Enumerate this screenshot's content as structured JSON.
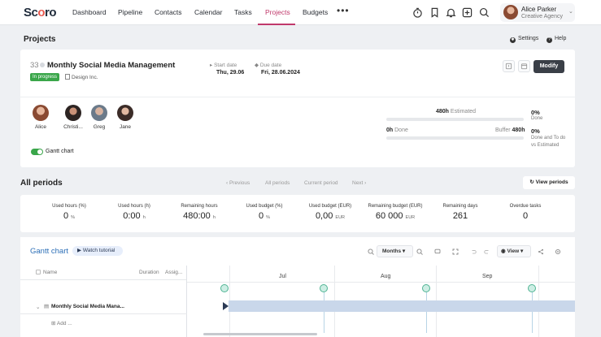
{
  "nav": {
    "logo_prefix": "Sc",
    "logo_o": "o",
    "logo_suffix": "ro",
    "items": [
      "Dashboard",
      "Pipeline",
      "Contacts",
      "Calendar",
      "Tasks",
      "Projects",
      "Budgets"
    ],
    "more": "•••",
    "active": "Projects"
  },
  "user": {
    "name": "Alice Parker",
    "agency": "Creative Agency"
  },
  "page": {
    "title": "Projects",
    "settings": "Settings",
    "help": "Help"
  },
  "project": {
    "number": "33",
    "title": "Monthly Social Media Management",
    "status": "In progress",
    "client": "Design Inc.",
    "start_label": "Start date",
    "start_value": "Thu, 29.06",
    "due_label": "Due date",
    "due_value": "Fri, 28.06.2024",
    "modify": "Modify"
  },
  "members": [
    {
      "name": "Alice"
    },
    {
      "name": "Christi..."
    },
    {
      "name": "Greg"
    },
    {
      "name": "Jane"
    }
  ],
  "gantt_toggle": {
    "label": "Gantt chart",
    "on": true
  },
  "stats": {
    "estimated_hours": "480h",
    "estimated_label": "Estimated",
    "done_hours": "0h",
    "done_label": "Done",
    "buffer_label": "Buffer",
    "buffer_hours": "480h",
    "pct_done": "0%",
    "pct_done_label": "Done",
    "pct_done_todo": "0%",
    "pct_done_todo_label1": "Done and To do",
    "pct_done_todo_label2": "vs Estimated"
  },
  "periods": {
    "title": "All periods",
    "previous": "‹ Previous",
    "all": "All periods",
    "current": "Current period",
    "next": "Next ›",
    "view": "View periods"
  },
  "metrics": [
    {
      "label": "Used hours (%)",
      "value": "0",
      "unit": "%"
    },
    {
      "label": "Used hours (h)",
      "value": "0:00",
      "unit": "h"
    },
    {
      "label": "Remaining hours",
      "value": "480:00",
      "unit": "h"
    },
    {
      "label": "Used budget (%)",
      "value": "0",
      "unit": "%"
    },
    {
      "label": "Used budget (EUR)",
      "value": "0,00",
      "unit": "EUR"
    },
    {
      "label": "Remaining budget (EUR)",
      "value": "60 000",
      "unit": "EUR"
    },
    {
      "label": "Remaining days",
      "value": "261",
      "unit": ""
    },
    {
      "label": "Overdue tasks",
      "value": "0",
      "unit": ""
    }
  ],
  "gantt": {
    "title": "Gantt chart",
    "tutorial": "Watch tutorial",
    "scale": "Months",
    "view": "View",
    "col_name": "Name",
    "col_duration": "Duration",
    "col_assignee": "Assig...",
    "months": [
      "Jul",
      "Aug",
      "Sep"
    ],
    "task": "Monthly Social Media Mana...",
    "add": "Add ..."
  },
  "colors": {
    "accent": "#c0396b",
    "status_green": "#3aa64a",
    "link_blue": "#2c6fb7",
    "bar_blue": "#c9d7ea",
    "milestone_green": "#4fb393"
  }
}
